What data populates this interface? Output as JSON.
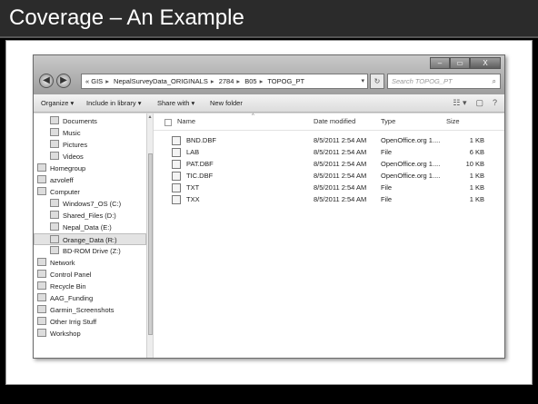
{
  "slide": {
    "title": "Coverage – An Example"
  },
  "explorer": {
    "window_controls": {
      "minimize": "–",
      "maximize": "▭",
      "close": "X"
    },
    "address": {
      "prefix": "«",
      "crumbs": [
        "GIS",
        "NepalSurveyData_ORIGINALS",
        "2784",
        "B05",
        "TOPOG_PT"
      ],
      "dropdown": "▾"
    },
    "refresh_glyph": "↻",
    "search": {
      "placeholder": "Search TOPOG_PT",
      "icon": "⌕"
    },
    "toolbar": {
      "organize": "Organize ▾",
      "include": "Include in library ▾",
      "share": "Share with ▾",
      "new_folder": "New folder",
      "views_icon": "☷ ▾",
      "preview_icon": "▢",
      "help_icon": "?"
    },
    "nav": [
      "Documents",
      "Music",
      "Pictures",
      "Videos",
      "Homegroup",
      "azvoleff",
      "Computer",
      "Windows7_OS (C:)",
      "Shared_Files (D:)",
      "Nepal_Data (E:)",
      "Orange_Data (R:)",
      "BD-ROM Drive (Z:)",
      "Network",
      "Control Panel",
      "Recycle Bin",
      "AAG_Funding",
      "Garmin_Screenshots",
      "Other Irrig Stuff",
      "Workshop"
    ],
    "nav_scroll_up": "▴",
    "columns": {
      "name": "Name",
      "date": "Date modified",
      "type": "Type",
      "size": "Size",
      "sort": "^"
    },
    "files": [
      {
        "name": "BND.DBF",
        "date": "8/5/2011 2:54 AM",
        "type": "OpenOffice.org 1....",
        "size": "1 KB"
      },
      {
        "name": "LAB",
        "date": "8/5/2011 2:54 AM",
        "type": "File",
        "size": "6 KB"
      },
      {
        "name": "PAT.DBF",
        "date": "8/5/2011 2:54 AM",
        "type": "OpenOffice.org 1....",
        "size": "10 KB"
      },
      {
        "name": "TIC.DBF",
        "date": "8/5/2011 2:54 AM",
        "type": "OpenOffice.org 1....",
        "size": "1 KB"
      },
      {
        "name": "TXT",
        "date": "8/5/2011 2:54 AM",
        "type": "File",
        "size": "1 KB"
      },
      {
        "name": "TXX",
        "date": "8/5/2011 2:54 AM",
        "type": "File",
        "size": "1 KB"
      }
    ]
  }
}
